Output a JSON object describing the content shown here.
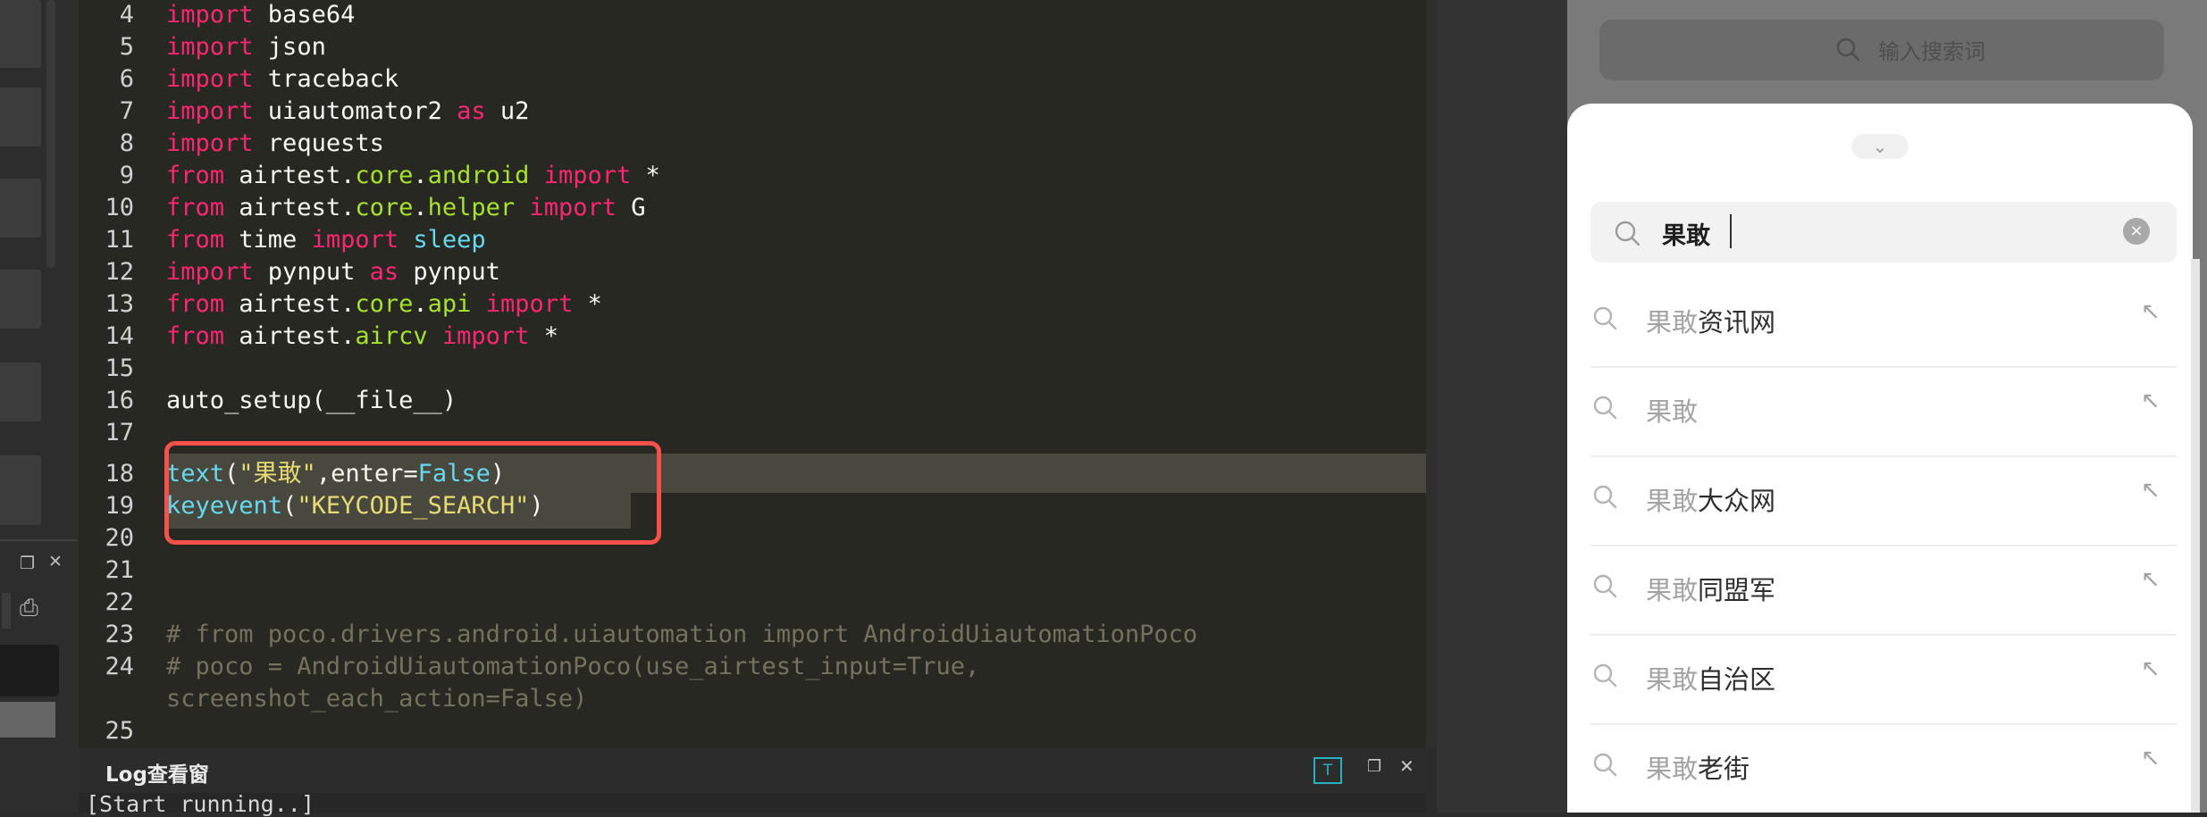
{
  "editor": {
    "lines": [
      {
        "num": "4",
        "parts": [
          [
            "kw",
            "import"
          ],
          [
            "t",
            " base64"
          ]
        ]
      },
      {
        "num": "5",
        "parts": [
          [
            "kw",
            "import"
          ],
          [
            "t",
            " json"
          ]
        ]
      },
      {
        "num": "6",
        "parts": [
          [
            "kw",
            "import"
          ],
          [
            "t",
            " traceback"
          ]
        ]
      },
      {
        "num": "7",
        "parts": [
          [
            "kw",
            "import"
          ],
          [
            "t",
            " uiautomator2 "
          ],
          [
            "kw",
            "as"
          ],
          [
            "t",
            " u2"
          ]
        ]
      },
      {
        "num": "8",
        "parts": [
          [
            "kw",
            "import"
          ],
          [
            "t",
            " requests"
          ]
        ]
      },
      {
        "num": "9",
        "parts": [
          [
            "kw",
            "from"
          ],
          [
            "t",
            " airtest."
          ],
          [
            "mod",
            "core"
          ],
          [
            "t",
            "."
          ],
          [
            "mod",
            "android"
          ],
          [
            "t",
            " "
          ],
          [
            "kw",
            "import"
          ],
          [
            "t",
            " *"
          ]
        ]
      },
      {
        "num": "10",
        "parts": [
          [
            "kw",
            "from"
          ],
          [
            "t",
            " airtest."
          ],
          [
            "mod",
            "core"
          ],
          [
            "t",
            "."
          ],
          [
            "mod",
            "helper"
          ],
          [
            "t",
            " "
          ],
          [
            "kw",
            "import"
          ],
          [
            "t",
            " G"
          ]
        ]
      },
      {
        "num": "11",
        "parts": [
          [
            "kw",
            "from"
          ],
          [
            "t",
            " time "
          ],
          [
            "kw",
            "import"
          ],
          [
            "t",
            " "
          ],
          [
            "fn",
            "sleep"
          ]
        ]
      },
      {
        "num": "12",
        "parts": [
          [
            "kw",
            "import"
          ],
          [
            "t",
            " pynput "
          ],
          [
            "kw",
            "as"
          ],
          [
            "t",
            " pynput"
          ]
        ]
      },
      {
        "num": "13",
        "parts": [
          [
            "kw",
            "from"
          ],
          [
            "t",
            " airtest."
          ],
          [
            "mod",
            "core"
          ],
          [
            "t",
            "."
          ],
          [
            "mod",
            "api"
          ],
          [
            "t",
            " "
          ],
          [
            "kw",
            "import"
          ],
          [
            "t",
            " *"
          ]
        ]
      },
      {
        "num": "14",
        "parts": [
          [
            "kw",
            "from"
          ],
          [
            "t",
            " airtest."
          ],
          [
            "mod",
            "aircv"
          ],
          [
            "t",
            " "
          ],
          [
            "kw",
            "import"
          ],
          [
            "t",
            " *"
          ]
        ]
      },
      {
        "num": "15",
        "parts": []
      },
      {
        "num": "16",
        "parts": [
          [
            "t",
            "auto_setup(__file__)"
          ]
        ]
      },
      {
        "num": "17",
        "parts": []
      },
      {
        "num": "18",
        "parts": [
          [
            "fn",
            "text"
          ],
          [
            "t",
            "("
          ],
          [
            "str",
            "\"果敢\""
          ],
          [
            "t",
            ",enter="
          ],
          [
            "fn",
            "False"
          ],
          [
            "t",
            ")"
          ]
        ]
      },
      {
        "num": "19",
        "parts": [
          [
            "fn",
            "keyevent"
          ],
          [
            "t",
            "("
          ],
          [
            "str",
            "\"KEYCODE_SEARCH\""
          ],
          [
            "t",
            ")"
          ]
        ]
      },
      {
        "num": "20",
        "parts": []
      },
      {
        "num": "21",
        "parts": []
      },
      {
        "num": "22",
        "parts": []
      },
      {
        "num": "23",
        "parts": [
          [
            "cm",
            "# from poco.drivers.android.uiautomation import AndroidUiautomationPoco"
          ]
        ]
      },
      {
        "num": "24",
        "parts": [
          [
            "cm",
            "# poco = AndroidUiautomationPoco(use_airtest_input=True,"
          ]
        ]
      },
      {
        "num": "",
        "parts": [
          [
            "cm",
            "screenshot_each_action=False)"
          ]
        ]
      },
      {
        "num": "",
        "parts": []
      },
      {
        "num": "25",
        "parts": []
      }
    ]
  },
  "log": {
    "title": "Log查看窗",
    "text": "[Start running..]",
    "filter_icon": "T",
    "restore_icon": "❐",
    "close_icon": "✕"
  },
  "left_panel": {
    "restore_icon": "❐",
    "close_icon": "✕",
    "record_icon": "⎙"
  },
  "phone": {
    "background_search_placeholder": "输入搜索词",
    "search_value": "果敢",
    "collapse_icon": "⌄",
    "clear_icon": "×",
    "suggestions": [
      {
        "match": "果敢",
        "rest": "资讯网"
      },
      {
        "match": "果敢",
        "rest": ""
      },
      {
        "match": "果敢",
        "rest": "大众网"
      },
      {
        "match": "果敢",
        "rest": "同盟军"
      },
      {
        "match": "果敢",
        "rest": "自治区"
      },
      {
        "match": "果敢",
        "rest": "老街"
      }
    ],
    "fill_icon": "↖"
  }
}
